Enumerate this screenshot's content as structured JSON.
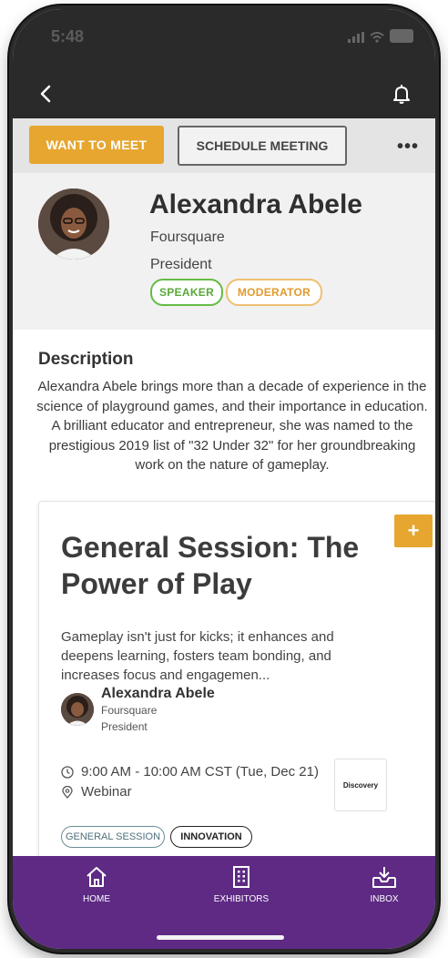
{
  "status_bar": {
    "time": "5:48"
  },
  "nav": {
    "back_icon": "chevron-left-icon",
    "notification_icon": "bell-icon"
  },
  "actions": {
    "want_to_meet": "WANT TO MEET",
    "schedule_meeting": "SCHEDULE MEETING",
    "more": "•••"
  },
  "profile": {
    "name": "Alexandra Abele",
    "company": "Foursquare",
    "title": "President",
    "tags": [
      "SPEAKER",
      "MODERATOR"
    ]
  },
  "description": {
    "heading": "Description",
    "text": "Alexandra Abele brings more than a decade of experience in the science of playground games, and their importance in education. A brilliant educator and entrepreneur, she was named to the prestigious 2019 list of \"32 Under 32\" for her groundbreaking work on the nature of gameplay."
  },
  "session": {
    "add_label": "+",
    "title": "General Session: The Power of Play",
    "description": "Gameplay isn't just for kicks; it enhances and deepens learning, fosters team bonding, and increases focus and engagemen...",
    "speaker": {
      "name": "Alexandra Abele",
      "company": "Foursquare",
      "title": "President"
    },
    "time": "9:00 AM - 10:00 AM CST (Tue, Dec 21)",
    "location": "Webinar",
    "sponsor": "Discovery",
    "tags": [
      "GENERAL SESSION",
      "INNOVATION"
    ]
  },
  "tabbar": {
    "items": [
      {
        "label": "HOME",
        "icon": "home-icon"
      },
      {
        "label": "EXHIBITORS",
        "icon": "building-icon"
      },
      {
        "label": "INBOX",
        "icon": "inbox-icon"
      }
    ]
  },
  "colors": {
    "accent": "#e6a62f",
    "tabbar": "#5e2a84",
    "header": "#2a2a2a",
    "speaker_tag": "#66bb44",
    "moderator_tag": "#efbf72"
  }
}
